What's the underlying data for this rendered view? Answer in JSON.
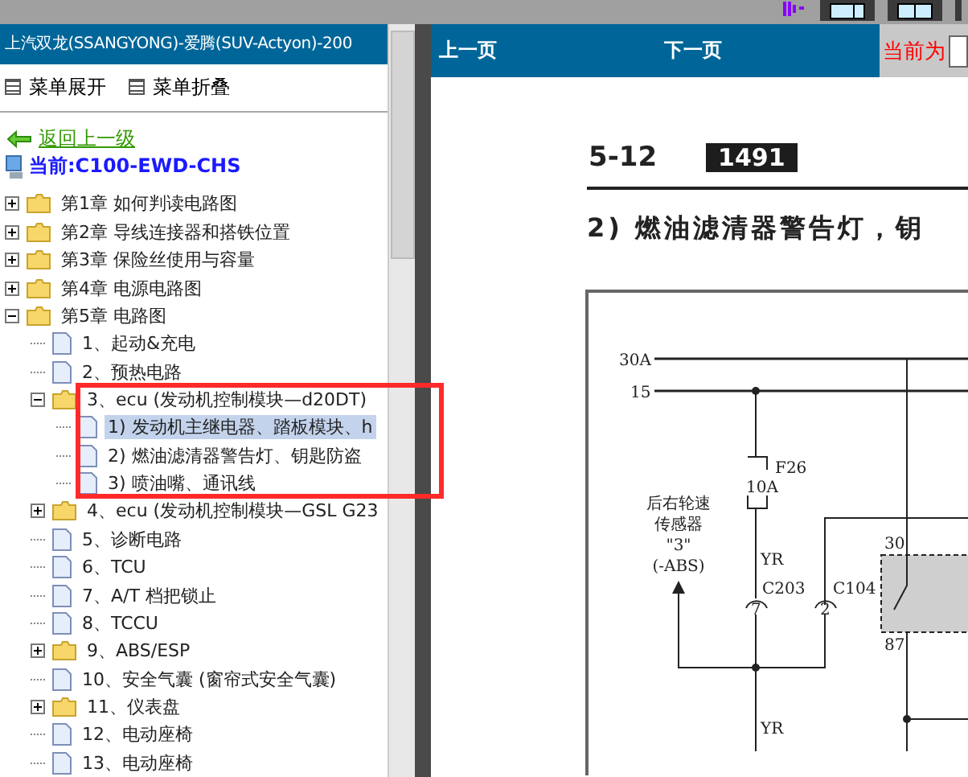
{
  "sidebar": {
    "title": "上汽双龙(SSANGYONG)-爱腾(SUV-Actyon)-200",
    "menu": [
      {
        "label": "菜单展开"
      },
      {
        "label": "菜单折叠"
      }
    ],
    "back_link": "返回上一级",
    "current": "当前:C100-EWD-CHS",
    "tree": [
      {
        "kind": "folder",
        "label": "第1章 如何判读电路图",
        "expanded": false,
        "selected": false
      },
      {
        "kind": "folder",
        "label": "第2章 导线连接器和搭铁位置",
        "expanded": false,
        "selected": false
      },
      {
        "kind": "folder",
        "label": "第3章 保险丝使用与容量",
        "expanded": false,
        "selected": false
      },
      {
        "kind": "folder",
        "label": "第4章 电源电路图",
        "expanded": false,
        "selected": false
      },
      {
        "kind": "folder",
        "label": "第5章 电路图",
        "expanded": true,
        "selected": false,
        "children": [
          {
            "kind": "doc",
            "label": "1、起动&充电",
            "selected": false
          },
          {
            "kind": "doc",
            "label": "2、预热电路",
            "selected": false
          },
          {
            "kind": "folder",
            "label": "3、ecu (发动机控制模块—d20DT)",
            "expanded": true,
            "selected": false,
            "children": [
              {
                "kind": "doc",
                "label": "1) 发动机主继电器、踏板模块、h",
                "selected": true
              },
              {
                "kind": "doc",
                "label": "2) 燃油滤清器警告灯、钥匙防盗",
                "selected": false
              },
              {
                "kind": "doc",
                "label": "3) 喷油嘴、通讯线",
                "selected": false
              }
            ]
          },
          {
            "kind": "folder",
            "label": "4、ecu (发动机控制模块—GSL G23",
            "expanded": false,
            "selected": false
          },
          {
            "kind": "doc",
            "label": "5、诊断电路",
            "selected": false
          },
          {
            "kind": "doc",
            "label": "6、TCU",
            "selected": false
          },
          {
            "kind": "doc",
            "label": "7、A/T 档把锁止",
            "selected": false
          },
          {
            "kind": "doc",
            "label": "8、TCCU",
            "selected": false
          },
          {
            "kind": "folder",
            "label": "9、ABS/ESP",
            "expanded": false,
            "selected": false
          },
          {
            "kind": "doc",
            "label": "10、安全气囊 (窗帘式安全气囊)",
            "selected": false
          },
          {
            "kind": "folder",
            "label": "11、仪表盘",
            "expanded": false,
            "selected": false
          },
          {
            "kind": "doc",
            "label": "12、电动座椅",
            "selected": false
          },
          {
            "kind": "doc",
            "label": "13、电动座椅",
            "selected": false
          }
        ]
      }
    ]
  },
  "viewer": {
    "prev": "上一页",
    "next": "下一页",
    "current_label": "当前为",
    "page": {
      "section": "5-12",
      "number": "1491",
      "heading": "2)  燃油滤清器警告灯，钥",
      "diagram": {
        "bus_1": "30A",
        "bus_2": "15",
        "fuse": "F26",
        "fuse_rating": "10A",
        "sensor": [
          "后右轮速",
          "传感器",
          "\"3\"",
          "(-ABS)"
        ],
        "wire_1": "YR",
        "connector_1": "C203",
        "pin_1": "7",
        "connector_2": "C104",
        "pin_2": "2",
        "relay_pin_1": "30",
        "relay_pin_2": "87",
        "wire_2": "YR"
      }
    }
  }
}
